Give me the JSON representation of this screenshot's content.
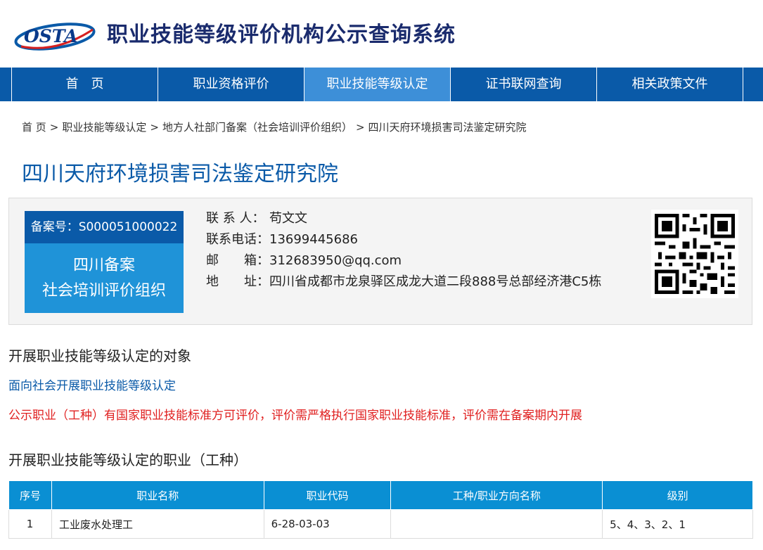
{
  "header": {
    "logo_text": "OSTA",
    "site_title": "职业技能等级评价机构公示查询系统"
  },
  "nav": {
    "items": [
      {
        "label": "首　页"
      },
      {
        "label": "职业资格评价"
      },
      {
        "label": "职业技能等级认定"
      },
      {
        "label": "证书联网查询"
      },
      {
        "label": "相关政策文件"
      }
    ],
    "active_index": 2
  },
  "breadcrumb": {
    "items": [
      "首  页",
      "职业技能等级认定",
      "地方人社部门备案（社会培训评价组织）",
      "四川天府环境损害司法鉴定研究院"
    ],
    "separator": ">"
  },
  "org": {
    "title": "四川天府环境损害司法鉴定研究院",
    "registration_no": "备案号：S000051000022",
    "type_line1": "四川备案",
    "type_line2": "社会培训评价组织",
    "contact": {
      "person_label": "联 系 人：",
      "person": "苟文文",
      "phone_label": "联系电话：",
      "phone": "13699445686",
      "email_label": "邮　　箱：",
      "email": "312683950@qq.com",
      "address_label": "地　　址：",
      "address": "四川省成都市龙泉驿区成龙大道二段888号总部经济港C5栋"
    }
  },
  "sections": {
    "target_title": "开展职业技能等级认定的对象",
    "target_text": "面向社会开展职业技能等级认定",
    "notice": "公示职业（工种）有国家职业技能标准方可评价，评价需严格执行国家职业技能标准，评价需在备案期内开展",
    "occupation_title": "开展职业技能等级认定的职业（工种）"
  },
  "table": {
    "headers": [
      "序号",
      "职业名称",
      "职业代码",
      "工种/职业方向名称",
      "级别"
    ],
    "rows": [
      {
        "no": "1",
        "name": "工业废水处理工",
        "code": "6-28-03-03",
        "direction": "",
        "level": "5、4、3、2、1"
      }
    ]
  }
}
